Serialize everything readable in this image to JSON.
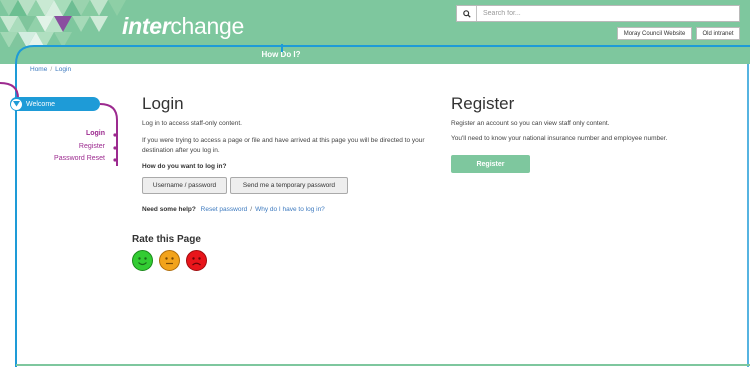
{
  "header": {
    "logo_bold": "inter",
    "logo_rest": "change",
    "search": {
      "placeholder": "Search for..."
    },
    "buttons": {
      "council": "Moray Council Website",
      "intranet": "Old intranet"
    },
    "how_do_i": "How Do I?"
  },
  "breadcrumb": {
    "home": "Home",
    "separator": "/",
    "current": "Login"
  },
  "sidebar": {
    "welcome": "Welcome",
    "items": [
      {
        "label": "Login"
      },
      {
        "label": "Register"
      },
      {
        "label": "Password Reset"
      }
    ]
  },
  "login": {
    "title": "Login",
    "intro": "Log in to access staff-only content.",
    "redirect": "If you were trying to access a page or file and have arrived at this page you will be directed to your destination after you log in.",
    "question": "How do you want to log in?",
    "btn_userpass": "Username / password",
    "btn_temp": "Send me a temporary password",
    "help_label": "Need some help?",
    "help_reset": "Reset password",
    "help_sep": "/",
    "help_why": "Why do I have to log in?"
  },
  "rating": {
    "title": "Rate this Page"
  },
  "register": {
    "title": "Register",
    "p1": "Register an account so you can view staff only content.",
    "p2": "You'll need to know your national insurance number and employee number.",
    "button": "Register"
  },
  "colors": {
    "brand_green": "#7ec79e",
    "line_blue": "#1e9bd7",
    "nav_purple": "#9c2a8f"
  }
}
